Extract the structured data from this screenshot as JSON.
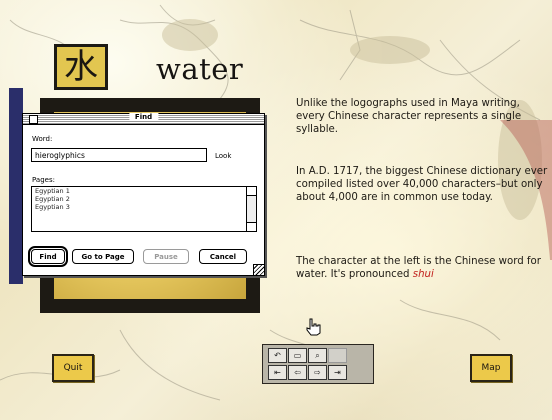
{
  "header": {
    "character": "水",
    "word": "water"
  },
  "description": {
    "paragraph1": "Unlike the logographs used in Maya writing, every Chinese character represents a single syllable.",
    "paragraph2": "In A.D. 1717, the biggest Chinese dictionary ever compiled listed over 40,000 characters–but only about 4,000 are in common use today.",
    "paragraph3_prefix": "The character at the left is the Chinese word for water. It's pronounced ",
    "pronunciation": "shui"
  },
  "find_dialog": {
    "title": "Find",
    "word_label": "Word:",
    "word_value": "hieroglyphics",
    "look_label": "Look",
    "pages_label": "Pages:",
    "pages": [
      "Egyptian 1",
      "Egyptian 2",
      "Egyptian 3"
    ],
    "buttons": {
      "find": "Find",
      "go_to_page": "Go to Page",
      "pause": "Pause",
      "cancel": "Cancel"
    }
  },
  "nav": {
    "quit": "Quit",
    "map": "Map"
  },
  "toolbar": {
    "buttons": [
      "back-arrow",
      "page-icon",
      "search-icon",
      "blank",
      "first-page",
      "previous",
      "next",
      "last-page"
    ]
  }
}
